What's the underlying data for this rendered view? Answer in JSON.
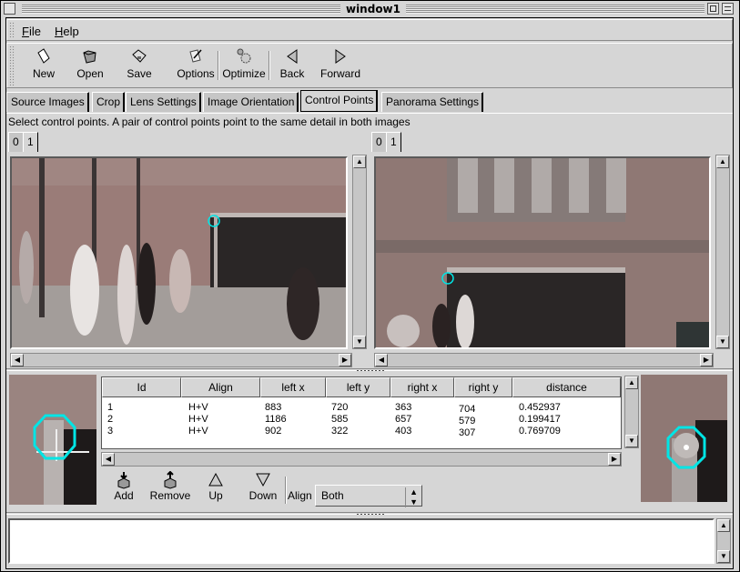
{
  "window": {
    "title": "window1"
  },
  "menu": {
    "items": [
      {
        "label": "File",
        "mnemonic": "F",
        "rest": "ile"
      },
      {
        "label": "Help",
        "mnemonic": "H",
        "rest": "elp"
      }
    ]
  },
  "toolbar": {
    "buttons": [
      {
        "label": "New",
        "icon": "new-file-icon"
      },
      {
        "label": "Open",
        "icon": "open-folder-icon"
      },
      {
        "label": "Save",
        "icon": "save-disk-icon"
      },
      {
        "label": "Options",
        "icon": "options-icon"
      },
      {
        "label": "Optimize",
        "icon": "gears-icon"
      },
      {
        "label": "Back",
        "icon": "arrow-left-icon"
      },
      {
        "label": "Forward",
        "icon": "arrow-right-icon"
      }
    ]
  },
  "tabs": [
    {
      "label": "Source Images",
      "active": false
    },
    {
      "label": "Crop",
      "active": false
    },
    {
      "label": "Lens Settings",
      "active": false
    },
    {
      "label": "Image Orientation",
      "active": false
    },
    {
      "label": "Control Points",
      "active": true
    },
    {
      "label": "Panorama Settings",
      "active": false
    }
  ],
  "hint": "Select control points. A pair of control points point to the same detail in both images",
  "left_image": {
    "tabs": [
      "0",
      "1"
    ],
    "active_tab": "1"
  },
  "right_image": {
    "tabs": [
      "0",
      "1"
    ],
    "active_tab": "1"
  },
  "marker_color": "#00e5e5",
  "table": {
    "columns": [
      "Id",
      "Align",
      "left x",
      "left y",
      "right x",
      "right y",
      "distance"
    ],
    "rows": [
      [
        "1",
        "H+V",
        "883",
        "720",
        "363",
        "704",
        "0.452937"
      ],
      [
        "2",
        "H+V",
        "1186",
        "585",
        "657",
        "579",
        "0.199417"
      ],
      [
        "3",
        "H+V",
        "902",
        "322",
        "403",
        "307",
        "0.769709"
      ]
    ]
  },
  "bottom_buttons": [
    {
      "label": "Add",
      "icon": "add-point-icon"
    },
    {
      "label": "Remove",
      "icon": "remove-point-icon"
    },
    {
      "label": "Up",
      "icon": "triangle-up-icon"
    },
    {
      "label": "Down",
      "icon": "triangle-down-icon"
    }
  ],
  "align": {
    "label": "Align",
    "value": "Both"
  },
  "console": {
    "text": ""
  }
}
